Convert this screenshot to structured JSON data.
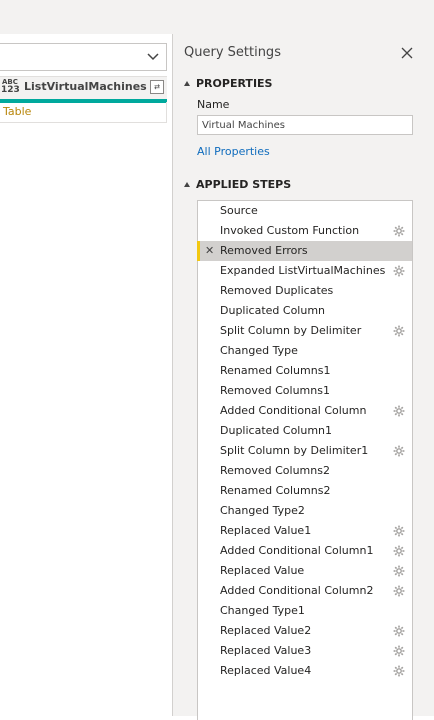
{
  "left_pane": {
    "column_header": {
      "type_top": "ABC",
      "type_bottom": "123",
      "name": "ListVirtualMachines"
    },
    "cell_value": "Table"
  },
  "query_settings": {
    "title": "Query Settings",
    "properties": {
      "heading": "PROPERTIES",
      "name_label": "Name",
      "name_value": "Virtual Machines",
      "all_properties_link": "All Properties"
    },
    "applied_steps": {
      "heading": "APPLIED STEPS",
      "steps": [
        {
          "label": "Source",
          "gear": false
        },
        {
          "label": "Invoked Custom Function",
          "gear": true
        },
        {
          "label": "Removed Errors",
          "gear": false,
          "selected": true
        },
        {
          "label": "Expanded ListVirtualMachines",
          "gear": true
        },
        {
          "label": "Removed Duplicates",
          "gear": false
        },
        {
          "label": "Duplicated Column",
          "gear": false
        },
        {
          "label": "Split Column by Delimiter",
          "gear": true
        },
        {
          "label": "Changed Type",
          "gear": false
        },
        {
          "label": "Renamed Columns1",
          "gear": false
        },
        {
          "label": "Removed Columns1",
          "gear": false
        },
        {
          "label": "Added Conditional Column",
          "gear": true
        },
        {
          "label": "Duplicated Column1",
          "gear": false
        },
        {
          "label": "Split Column by Delimiter1",
          "gear": true
        },
        {
          "label": "Removed Columns2",
          "gear": false
        },
        {
          "label": "Renamed Columns2",
          "gear": false
        },
        {
          "label": "Changed Type2",
          "gear": false
        },
        {
          "label": "Replaced Value1",
          "gear": true
        },
        {
          "label": "Added Conditional Column1",
          "gear": true
        },
        {
          "label": "Replaced Value",
          "gear": true
        },
        {
          "label": "Added Conditional Column2",
          "gear": true
        },
        {
          "label": "Changed Type1",
          "gear": false
        },
        {
          "label": "Replaced Value2",
          "gear": true
        },
        {
          "label": "Replaced Value3",
          "gear": true
        },
        {
          "label": "Replaced Value4",
          "gear": true
        }
      ]
    }
  },
  "colors": {
    "accent_teal": "#00a99d",
    "selected_marker": "#f2c811",
    "link": "#0f6cbd"
  }
}
